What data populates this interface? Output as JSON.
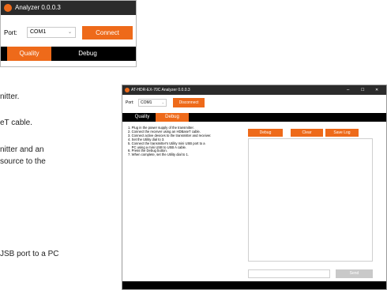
{
  "window_small": {
    "title": "Analyzer 0.0.0.3",
    "port_label": "Port:",
    "port_value": "COM1",
    "connect_label": "Connect",
    "tabs": [
      {
        "label": "Quality"
      },
      {
        "label": "Debug"
      }
    ]
  },
  "doc_fragments": [
    "nitter.",
    "eT cable.",
    "nitter and an",
    "source to the",
    "JSB port to a PC"
  ],
  "window_large": {
    "title": "AT-HDR-EX-70C Analyzer 0.0.0.3",
    "controls": {
      "minimize": "–",
      "maximize": "☐",
      "close": "✕"
    },
    "port_label": "Port:",
    "port_value": "COM1",
    "disconnect_label": "Disconnect",
    "tabs": [
      {
        "label": "Quality"
      },
      {
        "label": "Debug"
      }
    ],
    "instructions": [
      "1. Plug in the power supply of the transmitter.",
      "2. Connect the receiver using an HDBaseT cable.",
      "3. Connect active devices to the transmitter and receiver.",
      "4. Set the Utility dial to 3.",
      "5. Connect the transmitter's Utility mini USB port to a",
      "    PC using a mini USB to USB A cable.",
      "6. Press the Debug button.",
      "7. When complete, set the Utility dial to 1."
    ],
    "buttons": {
      "debug": "Debug",
      "clear": "Clear",
      "save_log": "Save Log",
      "send": "Send"
    }
  },
  "colors": {
    "accent": "#ee6a1a",
    "titlebar": "#2b2b2b",
    "tabbar": "#000000"
  }
}
